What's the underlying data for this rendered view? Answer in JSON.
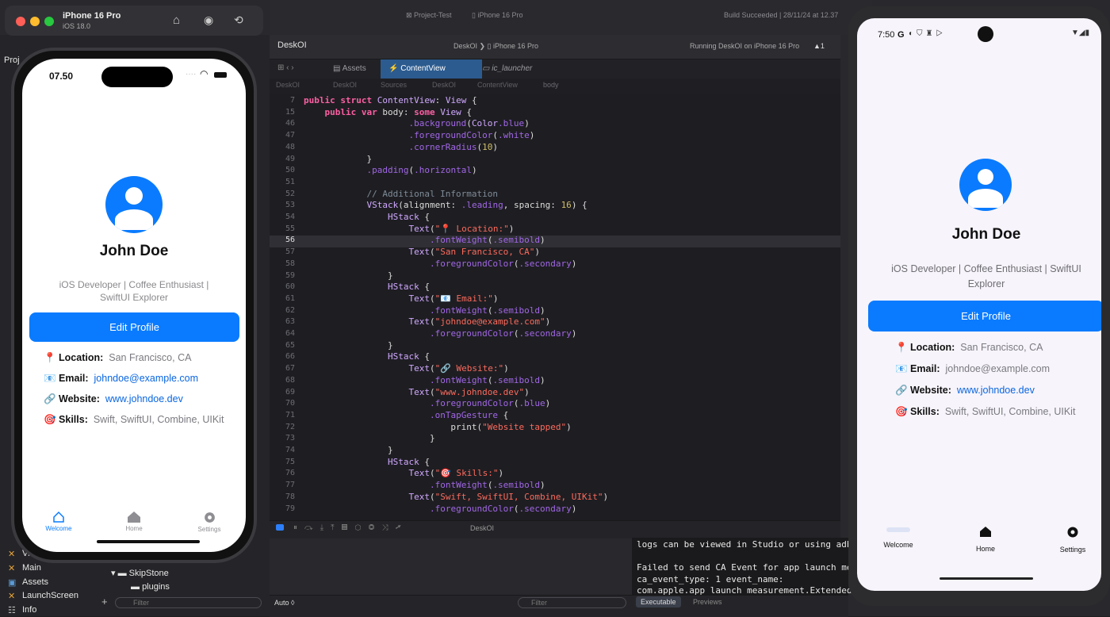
{
  "simulator": {
    "device": "iPhone 16 Pro",
    "os": "iOS 18.0",
    "status_time": "07.50"
  },
  "profile": {
    "name": "John Doe",
    "bio_line1": "iOS Developer | Coffee Enthusiast |",
    "bio_line2": "SwiftUI Explorer",
    "android_bio_line1": "iOS Developer | Coffee Enthusiast | SwiftUI",
    "android_bio_line2": "Explorer",
    "edit_button": "Edit Profile",
    "location_label": "📍 Location:",
    "location_value": "San Francisco, CA",
    "email_label": "📧 Email:",
    "email_value": "johndoe@example.com",
    "website_label": "🔗 Website:",
    "website_value": "www.johndoe.dev",
    "skills_label": "🎯 Skills:",
    "skills_value": "Swift, SwiftUI, Combine, UIKit"
  },
  "ios_tabs": [
    "Welcome",
    "Home",
    "Settings"
  ],
  "android": {
    "status_time": "7:50",
    "status_g": "G",
    "tabs": [
      "Welcome",
      "Home",
      "Settings"
    ]
  },
  "xcode": {
    "project": "DeskOI",
    "scheme_crumb": "Project-Test",
    "device_crumb": "iPhone 16 Pro",
    "build_status": "Build Succeeded | 28/11/24 at 12.37",
    "run_status": "Running DeskOI on iPhone 16 Pro",
    "warning_count": "1",
    "navigator_title": "Proj",
    "tabs": [
      "Assets",
      "ContentView",
      "ic_launcher"
    ],
    "jump_path": [
      "DeskOI",
      "DeskOI",
      "Sources",
      "DeskOI",
      "ContentView",
      "body"
    ],
    "navigator_items": [
      "Vi",
      "Main",
      "Assets",
      "LaunchScreen",
      "Info"
    ],
    "folder_items": [
      "SkipStone",
      "plugins"
    ],
    "filter_placeholder": "Filter",
    "auto_label": "Auto ◊",
    "executable_tab": "Executable",
    "previews_tab": "Previews",
    "debug_target": "DeskOI"
  },
  "code_lines": [
    {
      "n": "7",
      "t": "public struct ContentView: View {"
    },
    {
      "n": "15",
      "t": "    public var body: some View {"
    },
    {
      "n": "46",
      "t": "                    .background(Color.blue)"
    },
    {
      "n": "47",
      "t": "                    .foregroundColor(.white)"
    },
    {
      "n": "48",
      "t": "                    .cornerRadius(10)"
    },
    {
      "n": "49",
      "t": "            }"
    },
    {
      "n": "50",
      "t": "            .padding(.horizontal)"
    },
    {
      "n": "51",
      "t": ""
    },
    {
      "n": "52",
      "t": "            // Additional Information"
    },
    {
      "n": "53",
      "t": "            VStack(alignment: .leading, spacing: 16) {"
    },
    {
      "n": "54",
      "t": "                HStack {"
    },
    {
      "n": "55",
      "t": "                    Text(\"📍 Location:\")"
    },
    {
      "n": "56",
      "t": "                        .fontWeight(.semibold)"
    },
    {
      "n": "57",
      "t": "                    Text(\"San Francisco, CA\")"
    },
    {
      "n": "58",
      "t": "                        .foregroundColor(.secondary)"
    },
    {
      "n": "59",
      "t": "                }"
    },
    {
      "n": "60",
      "t": "                HStack {"
    },
    {
      "n": "61",
      "t": "                    Text(\"📧 Email:\")"
    },
    {
      "n": "62",
      "t": "                        .fontWeight(.semibold)"
    },
    {
      "n": "63",
      "t": "                    Text(\"johndoe@example.com\")"
    },
    {
      "n": "64",
      "t": "                        .foregroundColor(.secondary)"
    },
    {
      "n": "65",
      "t": "                }"
    },
    {
      "n": "66",
      "t": "                HStack {"
    },
    {
      "n": "67",
      "t": "                    Text(\"🔗 Website:\")"
    },
    {
      "n": "68",
      "t": "                        .fontWeight(.semibold)"
    },
    {
      "n": "69",
      "t": "                    Text(\"www.johndoe.dev\")"
    },
    {
      "n": "70",
      "t": "                        .foregroundColor(.blue)"
    },
    {
      "n": "71",
      "t": "                        .onTapGesture {"
    },
    {
      "n": "72",
      "t": "                            print(\"Website tapped\")"
    },
    {
      "n": "73",
      "t": "                        }"
    },
    {
      "n": "74",
      "t": "                }"
    },
    {
      "n": "75",
      "t": "                HStack {"
    },
    {
      "n": "76",
      "t": "                    Text(\"🎯 Skills:\")"
    },
    {
      "n": "77",
      "t": "                        .fontWeight(.semibold)"
    },
    {
      "n": "78",
      "t": "                    Text(\"Swift, SwiftUI, Combine, UIKit\")"
    },
    {
      "n": "79",
      "t": "                        .foregroundColor(.secondary)"
    }
  ],
  "console_lines": [
    "logs can be viewed in Studio or using adb",
    "",
    "Failed to send CA Event for app launch me",
    "ca_event_type: 1 event_name:",
    "com.apple.app_launch_measurement.Extended"
  ],
  "colors": {
    "accent": "#0a7bff",
    "link": "#0a66e0",
    "xcode_bg": "#1e1e22"
  }
}
